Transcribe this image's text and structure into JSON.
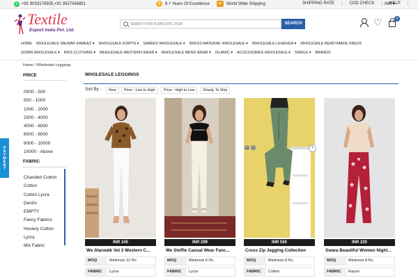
{
  "topbar": {
    "phone": "+91 9033176505,+91 9537548851",
    "experience": "8 + Years Of Excellence",
    "shipping_ww": "World Wide Shipping",
    "links": [
      "SHIPPING RATE",
      "COD CHECK",
      "HELP"
    ],
    "currency": "INR"
  },
  "logo": {
    "line1": "Textile",
    "line2": "Export India Pvt. Ltd."
  },
  "search": {
    "placeholder": "SEARCH FOR A SPECIFIC ITEM",
    "button": "SEARCH"
  },
  "header": {
    "cart_count": "0"
  },
  "nav": {
    "row1": [
      "HOME",
      "WHOLESALE SALWAR KAMEEZ ▾",
      "WHOLESALE KURTIS ▾",
      "SAREES WHOLESALE ▾",
      "DRESS MATERIAL WHOLESALE ▾",
      "WHOLESALE LEHENGA ▾",
      "WHOLESALE READYMADE DRESS"
    ],
    "row2": [
      "GOWN WHOLESALE ▾",
      "KIDS CLOTHING ▾",
      "WHOLESALE WESTERN WEAR ▾",
      "WHOLESALE MENS WEAR ▾",
      "ISLAMIC ▾",
      "ACCESSORIES WHOLESALE ▾",
      "SINGLE ▾",
      "BRANDS"
    ]
  },
  "breadcrumb": "Home / Wholesale Leggings",
  "sidebar": {
    "price_title": "PRICE",
    "prices": [
      "0000 - 500",
      "500 - 1000",
      "1000 - 2000",
      "2000 - 4000",
      "4000 - 6000",
      "6000 - 8000",
      "8000 - 10000",
      "10000 - Above"
    ],
    "fabric_title": "FABRIC",
    "fabrics": [
      "Chanderi Cotton",
      "Cotton",
      "Cotton Lycra",
      "Denim",
      "EMPTY",
      "Fancy Fabrics",
      "Hosiery Cotton",
      "Lycra",
      "Mix Fabric"
    ]
  },
  "payment_tab": "PAYMENT",
  "main": {
    "title": "WHOLESALE LEGGINGS",
    "sort_label": "Sort By :",
    "sort_options": [
      "New",
      "Price : Low to High",
      "Price : High to Low",
      "Ready To Ship"
    ]
  },
  "products": [
    {
      "price": "INR 245",
      "name": "We Starwalk Vol 3 Western C...",
      "moq_label": "MOQ",
      "moq": "Minimum 12 Pic",
      "fabric_label": "FABRIC",
      "fabric": "Lycra"
    },
    {
      "price": "INR 299",
      "name": "We Steffie Casual Wear Fanc...",
      "moq_label": "MOQ",
      "moq": "Minimum 6 Pic",
      "fabric_label": "FABRIC",
      "fabric": "Lycra"
    },
    {
      "price": "INR 550",
      "name": "Cross Zip Jegging Collection",
      "moq_label": "MOQ",
      "moq": "Minimum 8 Pic",
      "fabric_label": "FABRIC",
      "fabric": "Cotton"
    },
    {
      "price": "INR 220",
      "name": "Swara Beautiful Women Night...",
      "moq_label": "MOQ",
      "moq": "Minimum 8 Pic",
      "fabric_label": "FABRIC",
      "fabric": "Rayon"
    }
  ]
}
